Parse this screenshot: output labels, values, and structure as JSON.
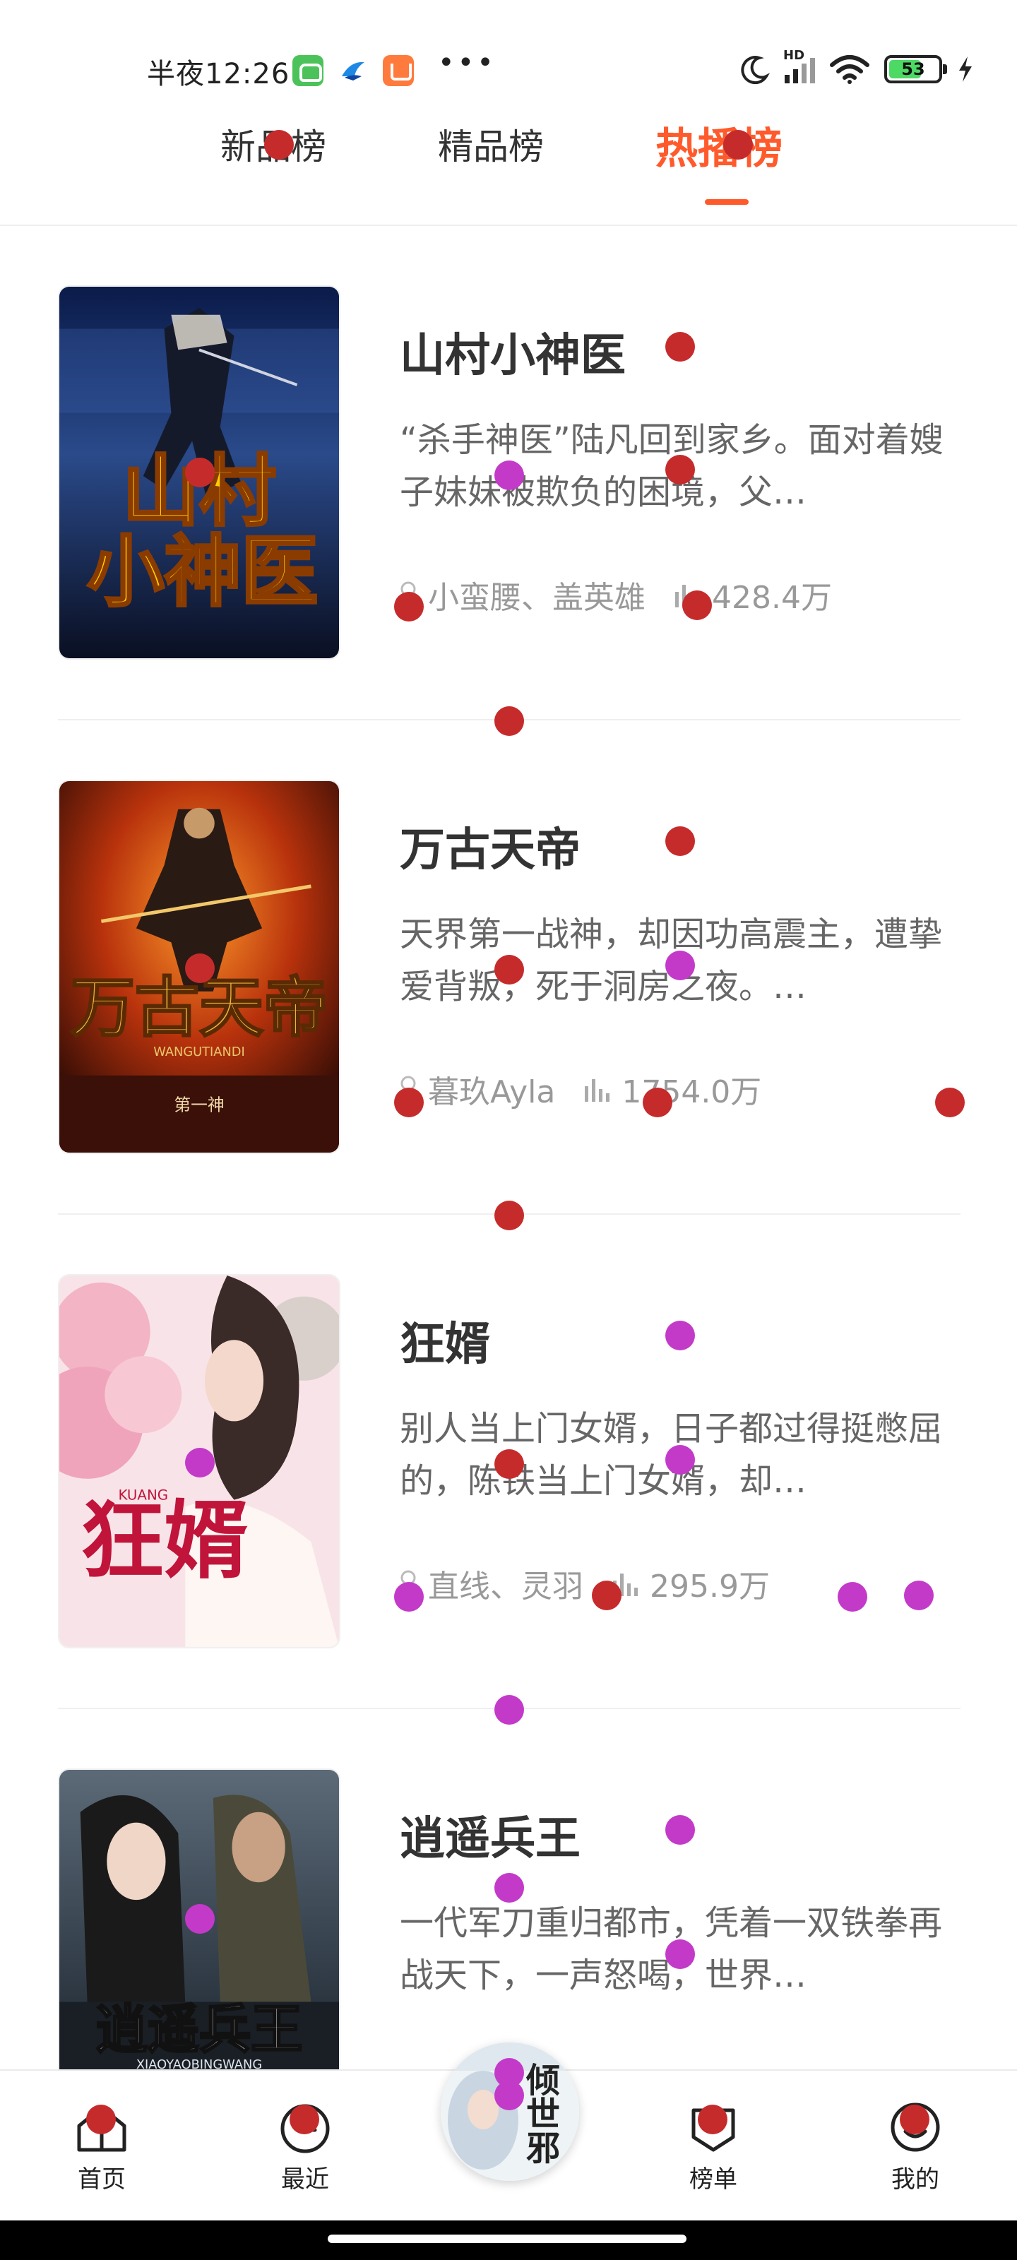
{
  "status_bar": {
    "time": "半夜12:26",
    "more": "•••",
    "signal_badge": "HD",
    "battery_level": "53",
    "icons": [
      "android-app-icon",
      "bird-app-icon",
      "shopping-bag-icon",
      "moon-icon",
      "signal-icon",
      "wifi-icon",
      "battery-icon",
      "charging-bolt-icon"
    ]
  },
  "tabs": [
    {
      "label": "新品榜",
      "active": false
    },
    {
      "label": "精品榜",
      "active": false
    },
    {
      "label": "热播榜",
      "active": true
    }
  ],
  "books": [
    {
      "title": "山村小神医",
      "description": "“杀手神医”陆凡回到家乡。面对着嫂子妹妹被欺负的困境，父…",
      "author": "小蛮腰、盖英雄",
      "plays": "428.4万",
      "cover_title": "山村小神医"
    },
    {
      "title": "万古天帝",
      "description": "天界第一战神，却因功高震主，遭挚爱背叛，死于洞房之夜。…",
      "author": "暮玖Ayla",
      "plays": "1754.0万",
      "cover_title": "万古天帝",
      "cover_sub": "WANGUTIANDI",
      "cover_author": "第一神"
    },
    {
      "title": "狂婿",
      "description": "别人当上门女婿，日子都过得挺憋屈的，陈铁当上门女婿，却…",
      "author": "直线、灵羽",
      "plays": "295.9万",
      "cover_title": "狂婿",
      "cover_sub": "KUANG"
    },
    {
      "title": "逍遥兵王",
      "description": "一代军刀重归都市，凭着一双铁拳再战天下，一声怒喝，世界…",
      "author": "",
      "plays": "",
      "cover_title": "逍遥兵王",
      "cover_sub": "XIAOYAOBINGWANG"
    }
  ],
  "bottom_nav": [
    {
      "label": "首页",
      "icon": "home-icon"
    },
    {
      "label": "最近",
      "icon": "recent-icon"
    },
    {
      "label": "",
      "icon": "now-playing-cover"
    },
    {
      "label": "榜单",
      "icon": "ranking-icon"
    },
    {
      "label": "我的",
      "icon": "profile-icon"
    }
  ],
  "now_playing_cover_text": "倾世邪",
  "colors": {
    "accent": "#ff5a2c",
    "text_primary": "#333333",
    "text_secondary": "#666666",
    "text_meta": "#999999",
    "overlay_red": "#c62b2b",
    "overlay_magenta": "#c33ac9"
  }
}
